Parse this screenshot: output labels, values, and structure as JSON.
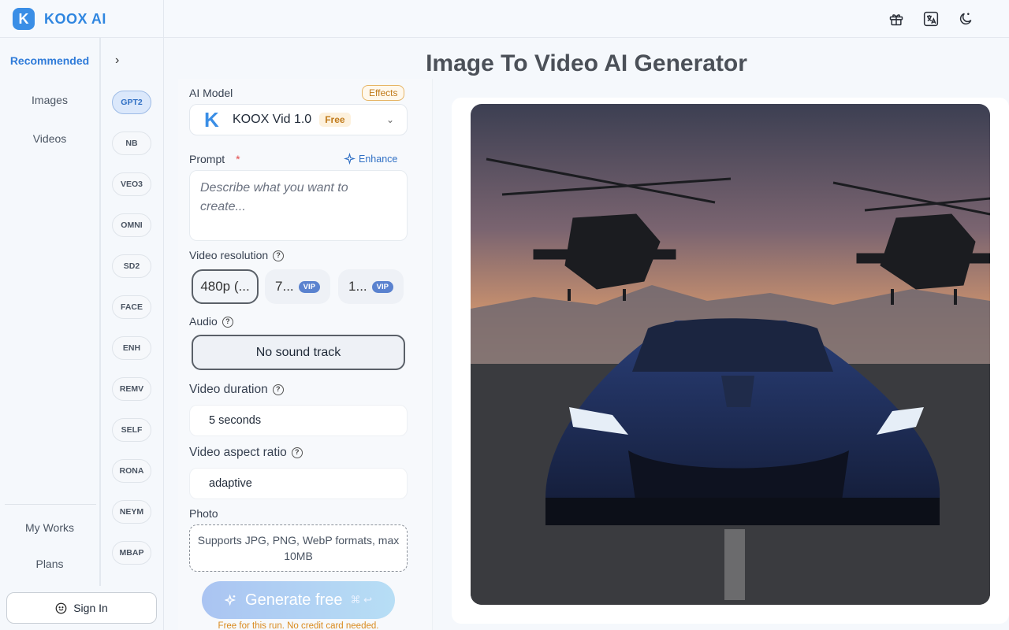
{
  "app": {
    "name": "KOOX AI",
    "logo_letter": "K"
  },
  "topbar_icons": [
    "gift-icon",
    "translate-icon",
    "moon-icon"
  ],
  "sidebar": {
    "items": [
      {
        "label": "Recommended",
        "active": true
      },
      {
        "label": "Images",
        "active": false
      },
      {
        "label": "Videos",
        "active": false
      }
    ],
    "bottom_items": [
      {
        "label": "My Works"
      },
      {
        "label": "Plans"
      }
    ],
    "sign_in_label": "Sign In"
  },
  "models": [
    "GPT2",
    "NB",
    "VEO3",
    "OMNI",
    "SD2",
    "FACE",
    "ENH",
    "REMV",
    "SELF",
    "RONA",
    "NEYM",
    "MBAP"
  ],
  "page": {
    "title": "Image To Video AI Generator"
  },
  "form": {
    "ai_model_label": "AI Model",
    "effects_label": "Effects",
    "model_name": "KOOX Vid 1.0",
    "model_badge": "Free",
    "prompt_label": "Prompt",
    "prompt_required": "*",
    "enhance_label": "Enhance",
    "prompt_placeholder": "Describe what you want to create...",
    "resolution_label": "Video resolution",
    "resolutions": [
      {
        "label": "480p (...",
        "vip": ""
      },
      {
        "label": "7...",
        "vip": "VIP"
      },
      {
        "label": "1...",
        "vip": "VIP"
      }
    ],
    "audio_label": "Audio",
    "audio_value": "No sound track",
    "duration_label": "Video duration",
    "duration_value": "5 seconds",
    "aspect_label": "Video aspect ratio",
    "aspect_value": "adaptive",
    "photo_label": "Photo",
    "photo_hint": "Supports JPG, PNG, WebP formats, max 10MB",
    "generate_label": "Generate free",
    "generate_shortcut": "⌘ ↩",
    "free_note": "Free for this run. No credit card needed."
  },
  "colors": {
    "accent": "#2f7bd9",
    "brand": "#3a8ee6",
    "warning": "#d98a1e",
    "vip": "#5a82cf"
  }
}
